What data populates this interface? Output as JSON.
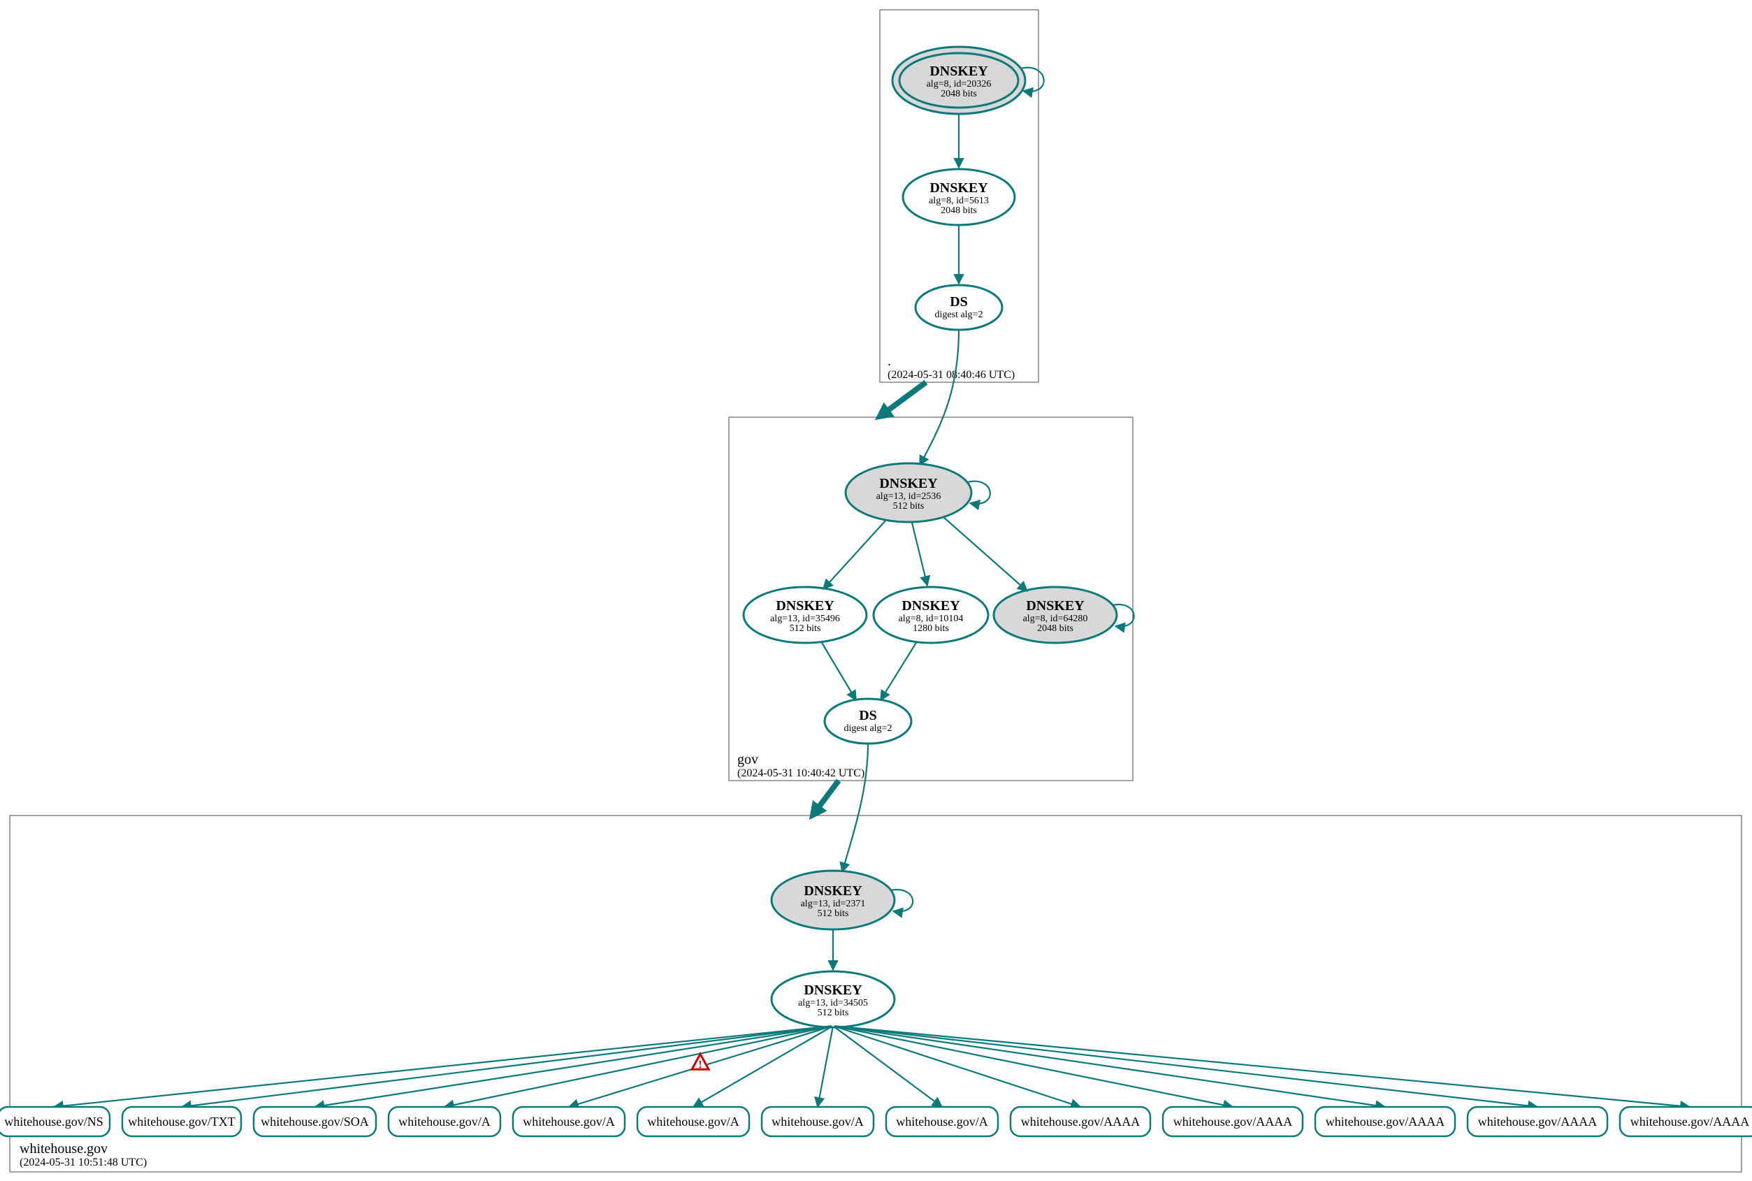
{
  "colors": {
    "stroke": "#0c7a7a",
    "fill_sep": "#d8d8d8",
    "fill_white": "#ffffff",
    "zone": "#666666",
    "warn": "#cc0000"
  },
  "zones": {
    "root": {
      "label": ".",
      "ts": "(2024-05-31 08:40:46 UTC)"
    },
    "gov": {
      "label": "gov",
      "ts": "(2024-05-31 10:40:42 UTC)"
    },
    "wh": {
      "label": "whitehouse.gov",
      "ts": "(2024-05-31 10:51:48 UTC)"
    }
  },
  "nodes": {
    "root_ksk": {
      "t": "DNSKEY",
      "s1": "alg=8, id=20326",
      "s2": "2048 bits"
    },
    "root_zsk": {
      "t": "DNSKEY",
      "s1": "alg=8, id=5613",
      "s2": "2048 bits"
    },
    "root_ds": {
      "t": "DS",
      "s1": "digest alg=2",
      "s2": ""
    },
    "gov_ksk": {
      "t": "DNSKEY",
      "s1": "alg=13, id=2536",
      "s2": "512 bits"
    },
    "gov_z1": {
      "t": "DNSKEY",
      "s1": "alg=13, id=35496",
      "s2": "512 bits"
    },
    "gov_z2": {
      "t": "DNSKEY",
      "s1": "alg=8, id=10104",
      "s2": "1280 bits"
    },
    "gov_z3": {
      "t": "DNSKEY",
      "s1": "alg=8, id=64280",
      "s2": "2048 bits"
    },
    "gov_ds": {
      "t": "DS",
      "s1": "digest alg=2",
      "s2": ""
    },
    "wh_ksk": {
      "t": "DNSKEY",
      "s1": "alg=13, id=2371",
      "s2": "512 bits"
    },
    "wh_zsk": {
      "t": "DNSKEY",
      "s1": "alg=13, id=34505",
      "s2": "512 bits"
    }
  },
  "rrsets": [
    "whitehouse.gov/NS",
    "whitehouse.gov/TXT",
    "whitehouse.gov/SOA",
    "whitehouse.gov/A",
    "whitehouse.gov/A",
    "whitehouse.gov/A",
    "whitehouse.gov/A",
    "whitehouse.gov/A",
    "whitehouse.gov/AAAA",
    "whitehouse.gov/AAAA",
    "whitehouse.gov/AAAA",
    "whitehouse.gov/AAAA",
    "whitehouse.gov/AAAA"
  ],
  "warn_edge_index": 4
}
